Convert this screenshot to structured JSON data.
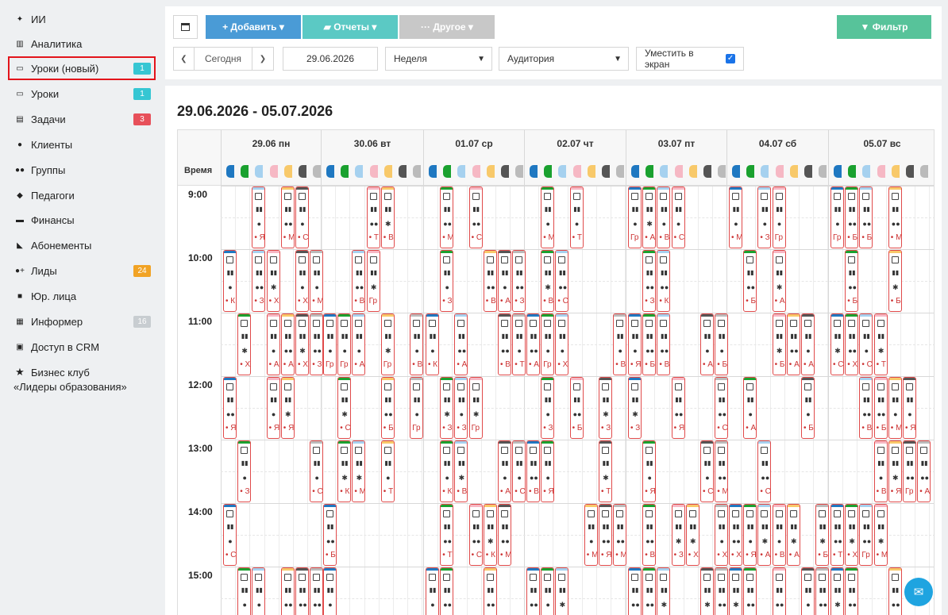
{
  "sidebar": {
    "items": [
      {
        "key": "ai",
        "icon": "sparkle-icon",
        "glyph": "✦",
        "label": "ИИ",
        "badge": "",
        "badge_color": ""
      },
      {
        "key": "analytics",
        "icon": "map-icon",
        "glyph": "▥",
        "label": "Аналитика",
        "badge": "",
        "badge_color": ""
      },
      {
        "key": "lessons-new",
        "icon": "calendar-icon",
        "glyph": "▭",
        "label": "Уроки (новый)",
        "badge": "1",
        "badge_color": "#36c6d3",
        "active": true
      },
      {
        "key": "lessons",
        "icon": "calendar-icon",
        "glyph": "▭",
        "label": "Уроки",
        "badge": "1",
        "badge_color": "#36c6d3"
      },
      {
        "key": "tasks",
        "icon": "clipboard-icon",
        "glyph": "▤",
        "label": "Задачи",
        "badge": "3",
        "badge_color": "#e7505a"
      },
      {
        "key": "clients",
        "icon": "user-icon",
        "glyph": "●",
        "label": "Клиенты",
        "badge": "",
        "badge_color": ""
      },
      {
        "key": "groups",
        "icon": "users-icon",
        "glyph": "●●",
        "label": "Группы",
        "badge": "",
        "badge_color": ""
      },
      {
        "key": "teachers",
        "icon": "graduation-cap-icon",
        "glyph": "◆",
        "label": "Педагоги",
        "badge": "",
        "badge_color": ""
      },
      {
        "key": "finance",
        "icon": "money-icon",
        "glyph": "▬",
        "label": "Финансы",
        "badge": "",
        "badge_color": ""
      },
      {
        "key": "subscriptions",
        "icon": "tag-icon",
        "glyph": "◣",
        "label": "Абонементы",
        "badge": "",
        "badge_color": ""
      },
      {
        "key": "leads",
        "icon": "user-plus-icon",
        "glyph": "●+",
        "label": "Лиды",
        "badge": "24",
        "badge_color": "#f1a325"
      },
      {
        "key": "legal",
        "icon": "briefcase-icon",
        "glyph": "■",
        "label": "Юр. лица",
        "badge": "",
        "badge_color": ""
      },
      {
        "key": "informer",
        "icon": "newspaper-icon",
        "glyph": "▦",
        "label": "Информер",
        "badge": "16",
        "badge_color": "#c8cdd1"
      },
      {
        "key": "access",
        "icon": "lock-icon",
        "glyph": "▣",
        "label": "Доступ в CRM",
        "badge": "",
        "badge_color": ""
      }
    ],
    "club": {
      "icon": "star-icon",
      "line1": "Бизнес клуб",
      "line2": "«Лидеры образования»"
    }
  },
  "toolbar": {
    "calendar_icon": "calendar-icon",
    "add_label": "+ Добавить ▾",
    "reports_label": "▰ Отчеты ▾",
    "other_label": "··· Другое ▾",
    "filter_label": "▼ Фильтр",
    "prev_label": "❮",
    "today_label": "Сегодня",
    "next_label": "❯",
    "date_value": "29.06.2026",
    "period_value": "Неделя",
    "group_value": "Аудитория",
    "fit_label": "Уместить в экран",
    "fit_checked": true
  },
  "calendar": {
    "range_title": "29.06.2026 - 05.07.2026",
    "time_header": "Время",
    "days": [
      "29.06 пн",
      "30.06 вт",
      "01.07 ср",
      "02.07 чт",
      "03.07 пт",
      "04.07 сб",
      "05.07 вс"
    ],
    "hours": [
      "9:00",
      "10:00",
      "11:00",
      "12:00",
      "13:00",
      "14:00",
      "15:00"
    ],
    "room_colors": [
      "#1f78c1",
      "#1aa12f",
      "#a6d1ef",
      "#f6b8c4",
      "#f8c96a",
      "#555555",
      "#bbbbbb"
    ]
  },
  "chat": {
    "icon": "chat-icon"
  }
}
